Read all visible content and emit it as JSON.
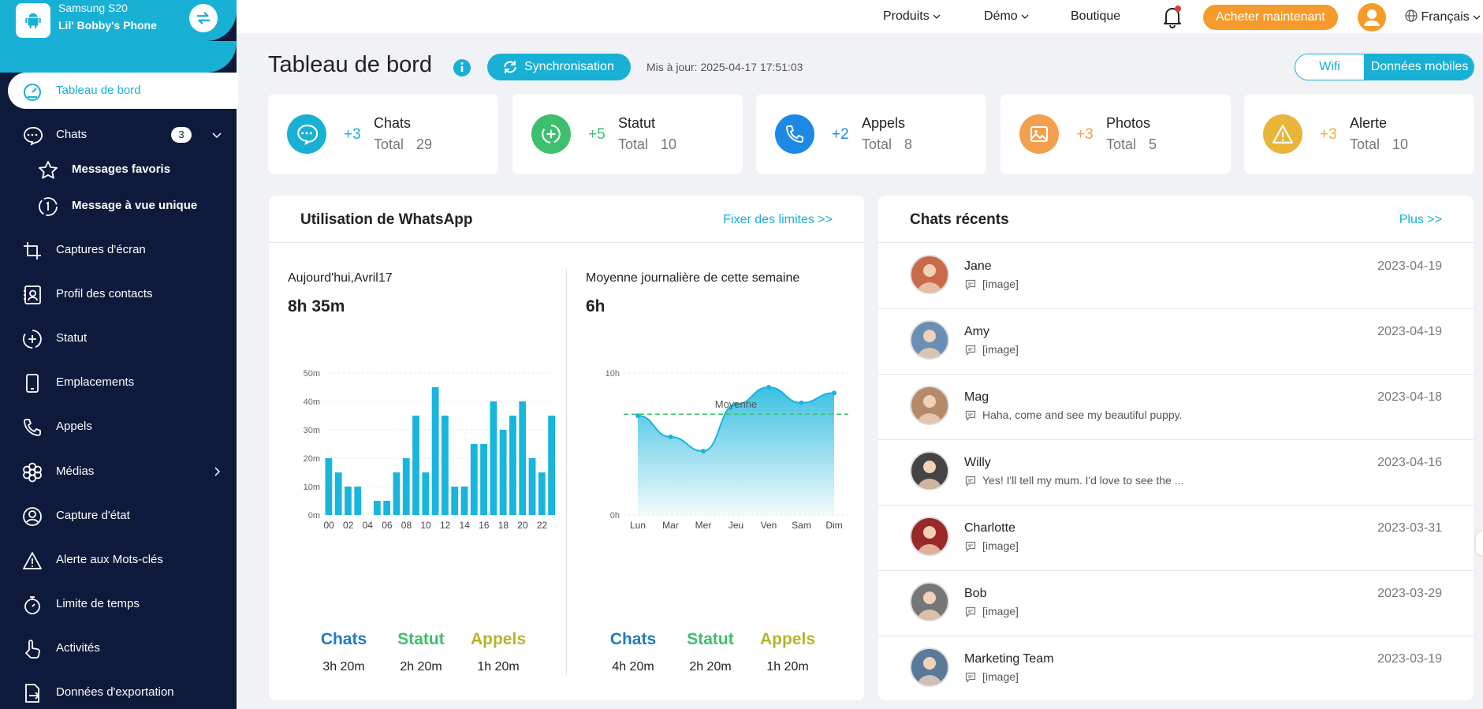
{
  "device": {
    "model": "Samsung S20",
    "name": "Lil' Bobby's Phone"
  },
  "sidebar": {
    "items": [
      {
        "key": "dashboard",
        "label": "Tableau de bord",
        "icon": "dashboard-gauge-icon"
      },
      {
        "key": "chats",
        "label": "Chats",
        "icon": "chat-bubble-icon",
        "badge": "3"
      },
      {
        "key": "favorites",
        "label": "Messages favoris",
        "icon": "star-icon"
      },
      {
        "key": "view-once",
        "label": "Message à vue unique",
        "icon": "view-once-icon"
      },
      {
        "key": "screenshots",
        "label": "Captures d'écran",
        "icon": "crop-icon"
      },
      {
        "key": "contacts",
        "label": "Profil des contacts",
        "icon": "contact-card-icon"
      },
      {
        "key": "status",
        "label": "Statut",
        "icon": "status-icon"
      },
      {
        "key": "locations",
        "label": "Emplacements",
        "icon": "phone-device-icon"
      },
      {
        "key": "calls",
        "label": "Appels",
        "icon": "phone-icon"
      },
      {
        "key": "media",
        "label": "Médias",
        "icon": "media-flower-icon"
      },
      {
        "key": "state-capture",
        "label": "Capture d'état",
        "icon": "user-circle-icon"
      },
      {
        "key": "keyword-alert",
        "label": "Alerte aux Mots-clés",
        "icon": "warning-icon"
      },
      {
        "key": "time-limit",
        "label": "Limite de temps",
        "icon": "stopwatch-icon"
      },
      {
        "key": "activities",
        "label": "Activités",
        "icon": "hand-pointer-icon"
      },
      {
        "key": "export",
        "label": "Données d'exportation",
        "icon": "export-icon"
      }
    ]
  },
  "topbar": {
    "products": "Produits",
    "demo": "Démo",
    "shop": "Boutique",
    "buy": "Acheter maintenant",
    "language": "Français"
  },
  "header": {
    "title": "Tableau de bord",
    "sync_label": "Synchronisation",
    "updated": "Mis à jour: 2025-04-17 17:51:03",
    "network_options": [
      "Wifi",
      "Données mobiles"
    ],
    "network_selected": "Données mobiles"
  },
  "stats": [
    {
      "name": "Chats",
      "delta": "+3",
      "total_label": "Total",
      "total": "29",
      "color": "#18b0d5",
      "icon": "chat-bubble-icon"
    },
    {
      "name": "Statut",
      "delta": "+5",
      "total_label": "Total",
      "total": "10",
      "color": "#3dbf6e",
      "icon": "status-icon"
    },
    {
      "name": "Appels",
      "delta": "+2",
      "total_label": "Total",
      "total": "8",
      "color": "#1e88e5",
      "icon": "phone-icon"
    },
    {
      "name": "Photos",
      "delta": "+3",
      "total_label": "Total",
      "total": "5",
      "color": "#f3a04e",
      "icon": "image-icon"
    },
    {
      "name": "Alerte",
      "delta": "+3",
      "total_label": "Total",
      "total": "10",
      "color": "#e8b53a",
      "icon": "warning-icon"
    }
  ],
  "usage": {
    "title": "Utilisation de WhatsApp",
    "link": "Fixer des limites >>",
    "today_label": "Aujourd'hui,Avril17",
    "today_value": "8h 35m",
    "week_label": "Moyenne journalière de cette semaine",
    "week_value": "6h",
    "today_legend": [
      {
        "name": "Chats",
        "value": "3h 20m",
        "color": "#1e7bbf"
      },
      {
        "name": "Statut",
        "value": "2h 20m",
        "color": "#3dbf6e"
      },
      {
        "name": "Appels",
        "value": "1h 20m",
        "color": "#b5b52a"
      }
    ],
    "week_legend": [
      {
        "name": "Chats",
        "value": "4h 20m",
        "color": "#1e7bbf"
      },
      {
        "name": "Statut",
        "value": "2h 20m",
        "color": "#3dbf6e"
      },
      {
        "name": "Appels",
        "value": "1h 20m",
        "color": "#b5b52a"
      }
    ]
  },
  "chart_data": [
    {
      "type": "bar",
      "title": "",
      "xlabel": "",
      "ylabel": "",
      "ylim": [
        0,
        50
      ],
      "y_ticks": [
        "0m",
        "10m",
        "20m",
        "30m",
        "40m",
        "50m"
      ],
      "x_ticks": [
        "00",
        "02",
        "04",
        "06",
        "08",
        "10",
        "12",
        "14",
        "16",
        "18",
        "20",
        "22"
      ],
      "series": [
        {
          "values": [
            20,
            15,
            10,
            10,
            0,
            5,
            5,
            15,
            20,
            35,
            15,
            45,
            35,
            10,
            10,
            25,
            25,
            40,
            30,
            35,
            40,
            20,
            15,
            35
          ]
        }
      ],
      "color": "#18b5dc",
      "grid": true
    },
    {
      "type": "area",
      "title": "",
      "xlabel": "",
      "ylabel": "",
      "ylim": [
        0,
        10
      ],
      "y_ticks": [
        "0h",
        "10h"
      ],
      "categories": [
        "Lun",
        "Mar",
        "Mer",
        "Jeu",
        "Ven",
        "Sam",
        "Dim"
      ],
      "values": [
        7.0,
        5.5,
        4.5,
        7.8,
        9.0,
        7.9,
        8.6
      ],
      "average": 7.1,
      "average_label": "Moyenne",
      "color": "#18b5dc",
      "average_color": "#3dbf6e"
    }
  ],
  "recent": {
    "title": "Chats récents",
    "link": "Plus >>",
    "items": [
      {
        "name": "Jane",
        "message": "[image]",
        "date": "2023-04-19",
        "avatar_color": "#c96a4a"
      },
      {
        "name": "Amy",
        "message": "[image]",
        "date": "2023-04-19",
        "avatar_color": "#6a8fb5"
      },
      {
        "name": "Mag",
        "message": "Haha, come and see my beautiful puppy.",
        "date": "2023-04-18",
        "avatar_color": "#b58a6a"
      },
      {
        "name": "Willy",
        "message": "Yes! I'll tell my mum. I'd love to see the ...",
        "date": "2023-04-16",
        "avatar_color": "#444444"
      },
      {
        "name": "Charlotte",
        "message": "[image]",
        "date": "2023-03-31",
        "avatar_color": "#9a2a2a"
      },
      {
        "name": "Bob",
        "message": "[image]",
        "date": "2023-03-29",
        "avatar_color": "#777777"
      },
      {
        "name": "Marketing Team",
        "message": "[image]",
        "date": "2023-03-19",
        "avatar_color": "#5a7a9a"
      }
    ]
  }
}
